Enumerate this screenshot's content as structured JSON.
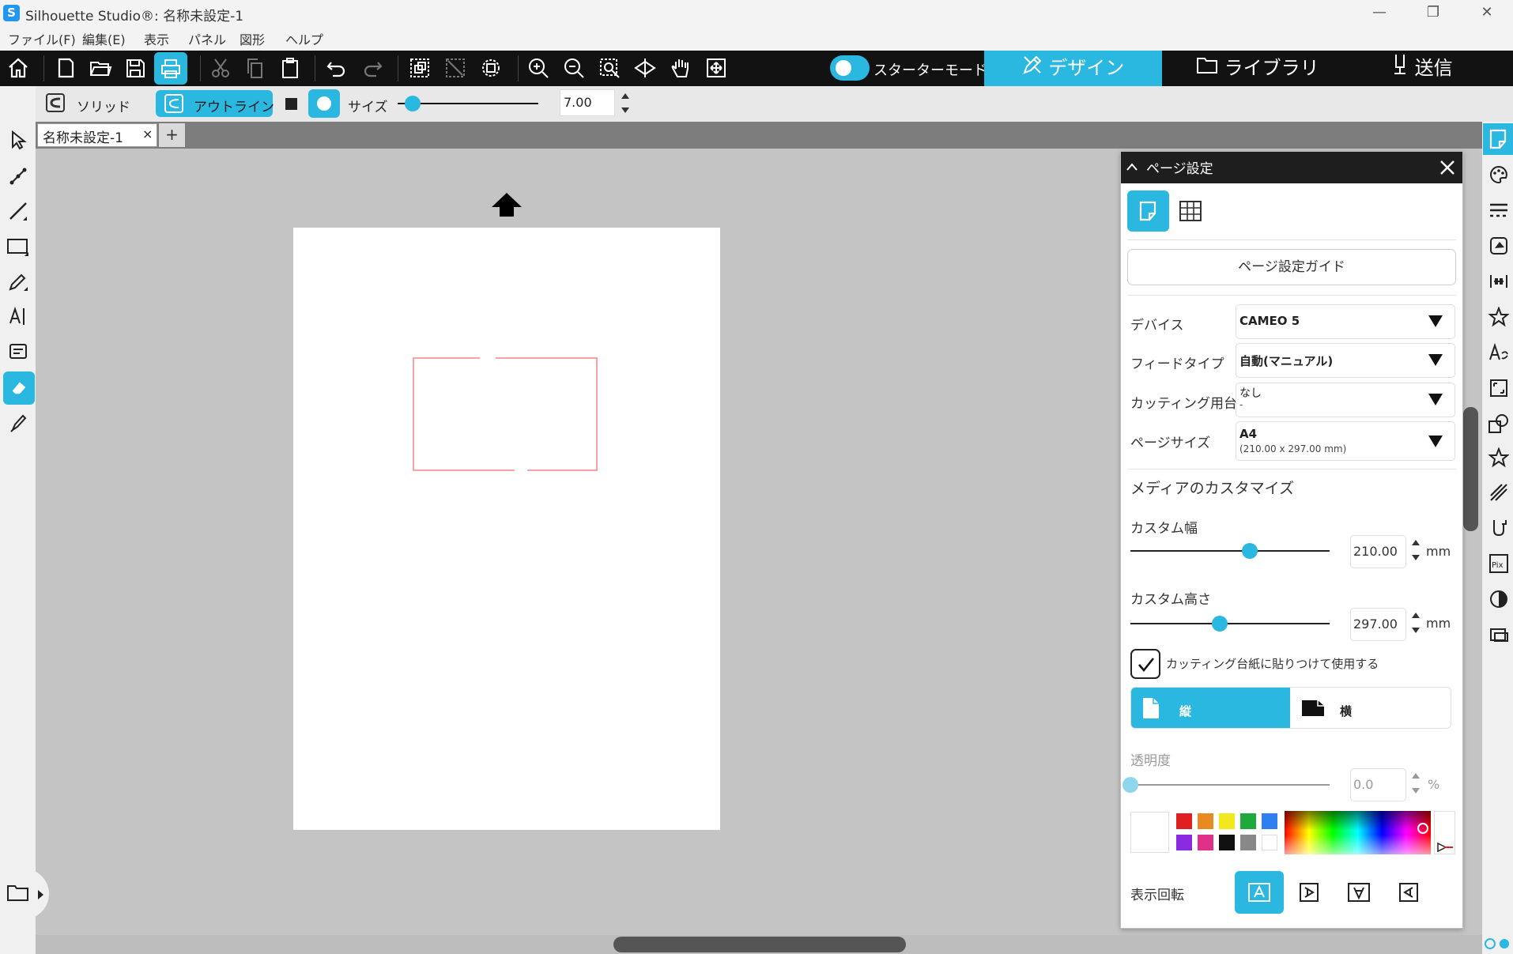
{
  "window": {
    "title": "Silhouette Studio®: 名称未設定-1",
    "controls": {
      "minimize": "—",
      "maximize": "❐",
      "close": "✕"
    }
  },
  "menu": [
    "ファイル(F)",
    "編集(E)",
    "表示",
    "パネル",
    "図形",
    "ヘルプ"
  ],
  "toolbar": {
    "starter_mode_label": "スターターモードオフ",
    "tabs": {
      "design": "デザイン",
      "library": "ライブラリ",
      "send": "送信"
    },
    "active_tab": "design"
  },
  "secondary_toolbar": {
    "solid_label": "ソリッド",
    "outline_label": "アウトライン",
    "size_label": "サイズ",
    "size_value": "7.00",
    "size_level": 0.05
  },
  "document": {
    "tab_label": "名称未設定-1",
    "tab_close": "×",
    "new_tab": "+"
  },
  "panel": {
    "title": "ページ設定",
    "guide_button": "ページ設定ガイド",
    "device": {
      "label": "デバイス",
      "value": "CAMEO 5"
    },
    "feed_type": {
      "label": "フィードタイプ",
      "value": "自動(マニュアル)"
    },
    "cutting_mat": {
      "label": "カッティング用台紙",
      "value": "なし",
      "sub": "-"
    },
    "page_size": {
      "label": "ページサイズ",
      "value": "A4",
      "sub": "(210.00 x 297.00 mm)"
    },
    "media_customize": "メディアのカスタマイズ",
    "custom_width": {
      "label": "カスタム幅",
      "value": "210.00",
      "unit": "mm",
      "level": 0.6
    },
    "custom_height": {
      "label": "カスタム高さ",
      "value": "297.00",
      "unit": "mm",
      "level": 0.45
    },
    "mat_checkbox": {
      "label": "カッティング台紙に貼りつけて使用する",
      "checked": true
    },
    "orientation": {
      "portrait": "縦",
      "landscape": "横",
      "selected": "portrait"
    },
    "transparency": {
      "label": "透明度",
      "value": "0.0",
      "unit": "%",
      "level": 0.0
    },
    "swatches": [
      "#e02020",
      "#e88a20",
      "#f2e81e",
      "#1eaa3a",
      "#2f7ff0",
      "#8a2be2",
      "#e0308a",
      "#111111",
      "#888888",
      "#ffffff"
    ],
    "rotation_label": "表示回転",
    "rotation_selected": 0
  },
  "colors": {
    "accent": "#2ab7e0",
    "shape_stroke": "#f4a4a4"
  }
}
